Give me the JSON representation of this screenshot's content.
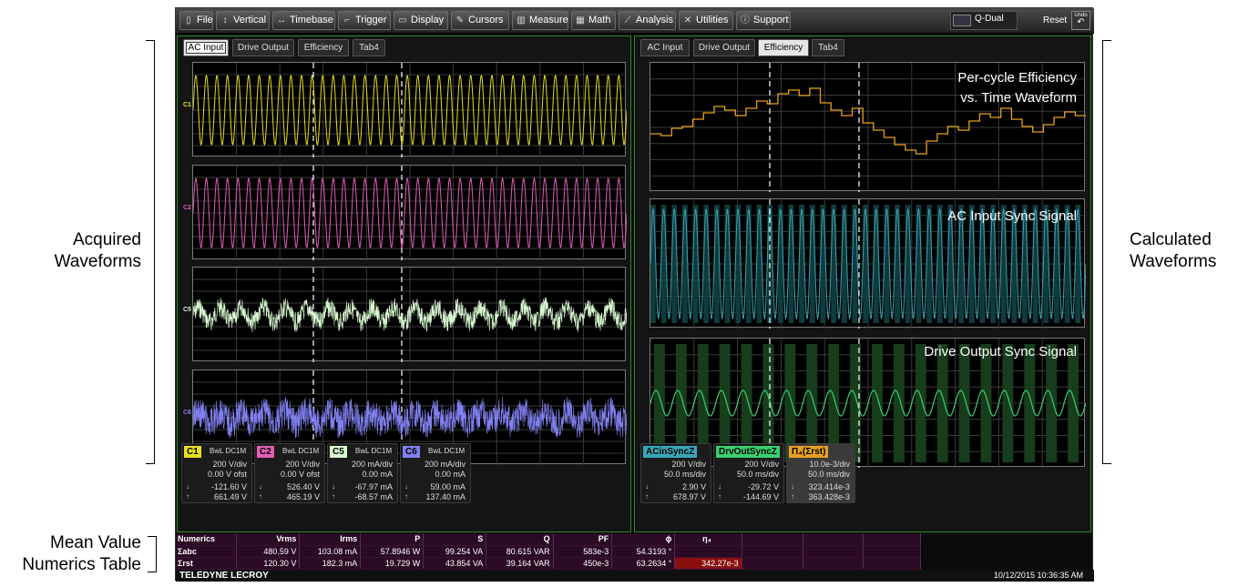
{
  "annotations": {
    "acquired_line1": "Acquired",
    "acquired_line2": "Waveforms",
    "mean_line1": "Mean Value",
    "mean_line2": "Numerics  Table",
    "calculated_line1": "Calculated",
    "calculated_line2": "Waveforms"
  },
  "menu": {
    "items": [
      {
        "label": "File",
        "icon": "file-icon",
        "glyph": "▯"
      },
      {
        "label": "Vertical",
        "icon": "vertical-arrows-icon",
        "glyph": "↕"
      },
      {
        "label": "Timebase",
        "icon": "horizontal-arrows-icon",
        "glyph": "↔"
      },
      {
        "label": "Trigger",
        "icon": "trigger-icon",
        "glyph": "⌐"
      },
      {
        "label": "Display",
        "icon": "display-icon",
        "glyph": "▭"
      },
      {
        "label": "Cursors",
        "icon": "cursor-icon",
        "glyph": "✎"
      },
      {
        "label": "Measure",
        "icon": "measure-icon",
        "glyph": "▥"
      },
      {
        "label": "Math",
        "icon": "calculator-icon",
        "glyph": "▦"
      },
      {
        "label": "Analysis",
        "icon": "analysis-icon",
        "glyph": "⟋"
      },
      {
        "label": "Utilities",
        "icon": "wrench-icon",
        "glyph": "✕"
      },
      {
        "label": "Support",
        "icon": "info-icon",
        "glyph": "ⓘ"
      }
    ],
    "layout_label": "Q-Dual",
    "reset_label": "Reset",
    "undo_label": "Undo"
  },
  "left_panel": {
    "tabs": [
      "AC Input",
      "Drive Output",
      "Efficiency",
      "Tab4"
    ],
    "active_tab": 0
  },
  "right_panel": {
    "tabs": [
      "AC Input",
      "Drive Output",
      "Efficiency",
      "Tab4"
    ],
    "active_tab": 2,
    "waveform_titles": {
      "efficiency_line1": "Per-cycle Efficiency",
      "efficiency_line2": "vs. Time Waveform",
      "ac_sync": "AC Input Sync Signal",
      "drive_sync": "Drive Output Sync Signal"
    }
  },
  "channels_left": [
    {
      "name": "C1",
      "color": "#e6e020",
      "row1": "BwL  DC1M",
      "row2": "200 V/div",
      "row3": "0.00 V ofst",
      "row4": "-121.60 V",
      "row5": "661.49 V"
    },
    {
      "name": "C2",
      "color": "#e45db8",
      "row1": "BwL  DC1M",
      "row2": "200 V/div",
      "row3": "0.00 V ofst",
      "row4": "526.40 V",
      "row5": "465.19 V"
    },
    {
      "name": "C5",
      "color": "#d8f8d0",
      "row1": "BwL  DC1M",
      "row2": "200 mA/div",
      "row3": "0.00 mA",
      "row4": "-67.97 mA",
      "row5": "-68.57 mA"
    },
    {
      "name": "C6",
      "color": "#8080f0",
      "row1": "BwL  DC1M",
      "row2": "200 mA/div",
      "row3": "0.00 mA",
      "row4": "59.00 mA",
      "row5": "137.40 mA"
    }
  ],
  "channels_right": [
    {
      "name": "ACinSyncZ",
      "color": "#3aa6b8",
      "row2": "200 V/div",
      "row3": "50.0 ms/div",
      "row4": "2.90 V",
      "row5": "678.97 V"
    },
    {
      "name": "DrvOutSyncZ",
      "color": "#3ad070",
      "row2": "200 V/div",
      "row3": "50.0 ms/div",
      "row4": "-29.72 V",
      "row5": "-144.69 V"
    },
    {
      "name": "Π₄(Σrst)",
      "color": "#e8a020",
      "row2": "10.0e-3/div",
      "row3": "50.0 ms/div",
      "row4": "323.414e-3",
      "row5": "363.428e-3"
    }
  ],
  "numerics": {
    "headers": [
      "Numerics",
      "Vrms",
      "Irms",
      "P",
      "S",
      "Q",
      "PF",
      "ϕ",
      "η₄"
    ],
    "rows": [
      [
        "Σabc",
        "480.59 V",
        "103.08 mA",
        "57.8946 W",
        "99.254 VA",
        "80.615 VAR",
        "583e-3",
        "54.3193 °",
        ""
      ],
      [
        "Σrst",
        "120.30 V",
        "182.3 mA",
        "19.729 W",
        "43.854 VA",
        "39.164 VAR",
        "450e-3",
        "63.2634 °",
        "342.27e-3"
      ]
    ]
  },
  "status": {
    "brand": "TELEDYNE LECROY",
    "datetime": "10/12/2015 10:36:35 AM"
  }
}
